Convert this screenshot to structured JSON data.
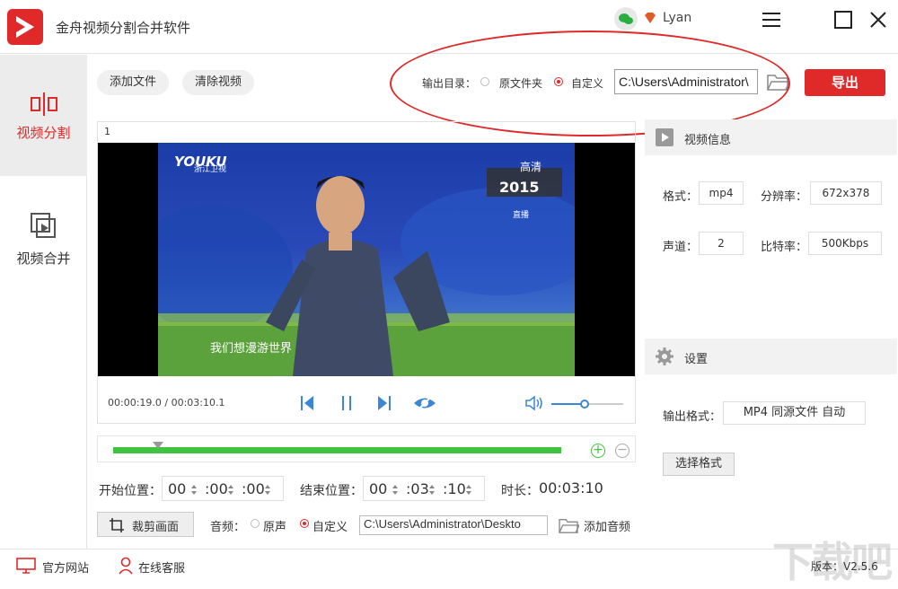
{
  "app": {
    "title": "金舟视频分割合并软件",
    "user": "Lyan"
  },
  "sidebar": {
    "items": [
      {
        "label": "视频分割"
      },
      {
        "label": "视频合并"
      }
    ]
  },
  "toolbar": {
    "add_file": "添加文件",
    "clear_video": "清除视频",
    "output_dir_label": "输出目录：",
    "option_source": "原文件夹",
    "option_custom": "自定义",
    "output_path": "C:\\Users\\Administrator\\",
    "export": "导出"
  },
  "player": {
    "index": "1",
    "logo": "YOUKU",
    "channel": "浙江卫视",
    "hd_badge": "高清",
    "year_badge": "2015",
    "live_badge": "直播",
    "subtitle": "我们想漫游世界",
    "time": "00:00:19.0 / 00:03:10.1",
    "volume_fraction": 0.45
  },
  "timeline": {
    "start_fraction": 0.1,
    "end_fraction": 1.0
  },
  "trim": {
    "start_label": "开始位置：",
    "start": [
      "00",
      ":00",
      ":00"
    ],
    "end_label": "结束位置：",
    "end": [
      "00",
      ":03",
      ":10"
    ],
    "duration_label": "时长：",
    "duration": "00:03:10"
  },
  "tools": {
    "crop": "裁剪画面",
    "audio_label": "音频：",
    "audio_original": "原声",
    "audio_custom": "自定义",
    "audio_path": "C:\\Users\\Administrator\\Deskto",
    "add_audio": "添加音频"
  },
  "video_info": {
    "heading": "视频信息",
    "format_label": "格式：",
    "format": "mp4",
    "resolution_label": "分辨率：",
    "resolution": "672x378",
    "channels_label": "声道：",
    "channels": "2",
    "bitrate_label": "比特率：",
    "bitrate": "500Kbps"
  },
  "settings": {
    "heading": "设置",
    "output_format_label": "输出格式：",
    "output_format": "MP4 同源文件 自动",
    "choose_format": "选择格式"
  },
  "footer": {
    "website": "官方网站",
    "support": "在线客服",
    "version": "版本：V2.5.6",
    "watermark": "下载吧"
  },
  "colors": {
    "accent": "#e02a2a",
    "progress": "#3fc23f",
    "player_blue": "#3b86d6"
  },
  "icons": [
    "app-logo-icon",
    "wechat-icon",
    "vip-diamond-icon",
    "menu-icon",
    "maximize-icon",
    "close-icon",
    "split-icon",
    "merge-icon",
    "folder-icon",
    "rewind-icon",
    "pause-icon",
    "forward-icon",
    "eye-icon",
    "volume-icon",
    "zoom-in-icon",
    "zoom-out-icon",
    "crop-icon",
    "play-square-icon",
    "gear-icon",
    "monitor-icon",
    "person-icon"
  ]
}
